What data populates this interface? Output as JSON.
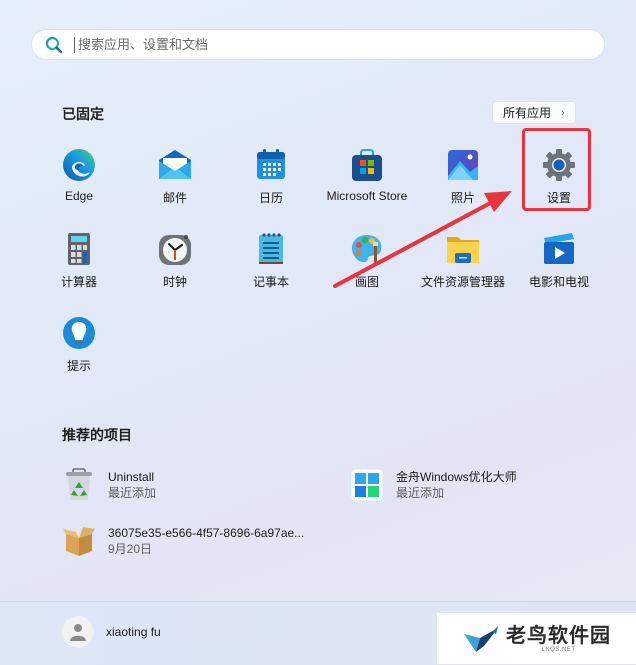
{
  "search": {
    "placeholder": "搜索应用、设置和文档",
    "icon": "search-icon"
  },
  "pinned": {
    "title": "已固定",
    "all_apps_label": "所有应用",
    "all_apps_icon": "chevron-right-icon",
    "apps": [
      {
        "label": "Edge",
        "icon": "edge-icon"
      },
      {
        "label": "邮件",
        "icon": "mail-icon"
      },
      {
        "label": "日历",
        "icon": "calendar-icon"
      },
      {
        "label": "Microsoft Store",
        "icon": "store-icon"
      },
      {
        "label": "照片",
        "icon": "photos-icon"
      },
      {
        "label": "设置",
        "icon": "settings-gear-icon"
      },
      {
        "label": "计算器",
        "icon": "calculator-icon"
      },
      {
        "label": "时钟",
        "icon": "clock-icon"
      },
      {
        "label": "记事本",
        "icon": "notepad-icon"
      },
      {
        "label": "画图",
        "icon": "paint-palette-icon"
      },
      {
        "label": "文件资源管理器",
        "icon": "folder-icon"
      },
      {
        "label": "电影和电视",
        "icon": "movies-play-icon"
      },
      {
        "label": "提示",
        "icon": "tips-lightbulb-icon"
      }
    ]
  },
  "recommended": {
    "title": "推荐的项目",
    "items": [
      {
        "name": "Uninstall",
        "sub": "最近添加",
        "icon": "recycle-bin-icon"
      },
      {
        "name": "金舟Windows优化大师",
        "sub": "最近添加",
        "icon": "windows-tiles-icon"
      },
      {
        "name": "36075e35-e566-4f57-8696-6a97ae...",
        "sub": "9月20日",
        "icon": "package-box-icon"
      }
    ]
  },
  "user": {
    "name": "xiaoting fu",
    "icon": "user-avatar-icon"
  },
  "annotation": {
    "highlight_target": "设置",
    "color": "#e8343c"
  },
  "watermark": {
    "main": "老鸟软件园",
    "sub": "LNQS.NET",
    "icon": "bird-logo-icon"
  }
}
